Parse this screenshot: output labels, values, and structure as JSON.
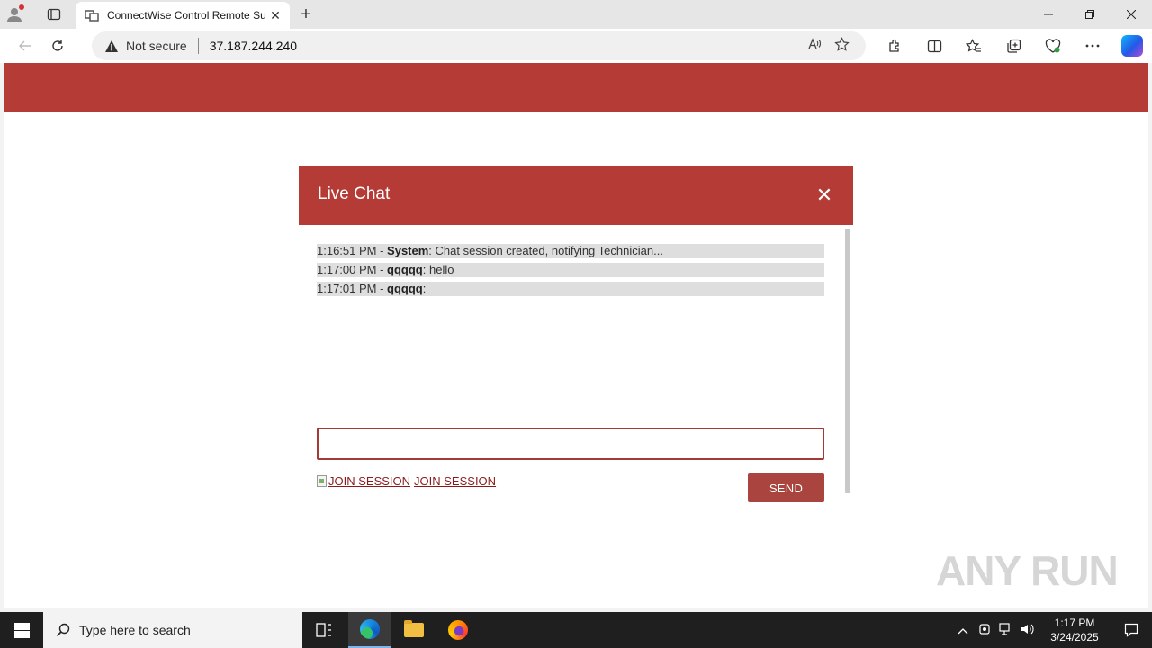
{
  "browser": {
    "tab_title": "ConnectWise Control Remote Su",
    "tab_close": "✕",
    "new_tab": "+",
    "security_label": "Not secure",
    "url": "37.187.244.240"
  },
  "chat": {
    "title": "Live Chat",
    "close_symbol": "✕",
    "messages": [
      {
        "time": "1:16:51 PM - ",
        "sender": "System",
        "text": ": Chat session created, notifying Technician..."
      },
      {
        "time": "1:17:00 PM - ",
        "sender": "qqqqq",
        "text": ": hello"
      },
      {
        "time": "1:17:01 PM - ",
        "sender": "qqqqq",
        "text": ":"
      }
    ],
    "input_value": "",
    "join_image_alt": "JOIN SESSION",
    "join_link": "JOIN SESSION",
    "send_label": "SEND"
  },
  "watermark": "ANY RUN",
  "taskbar": {
    "search_placeholder": "Type here to search",
    "time": "1:17 PM",
    "date": "3/24/2025"
  },
  "colors": {
    "brand_red": "#b53c36",
    "send_button": "#a9443e",
    "link": "#8b1a1a"
  }
}
